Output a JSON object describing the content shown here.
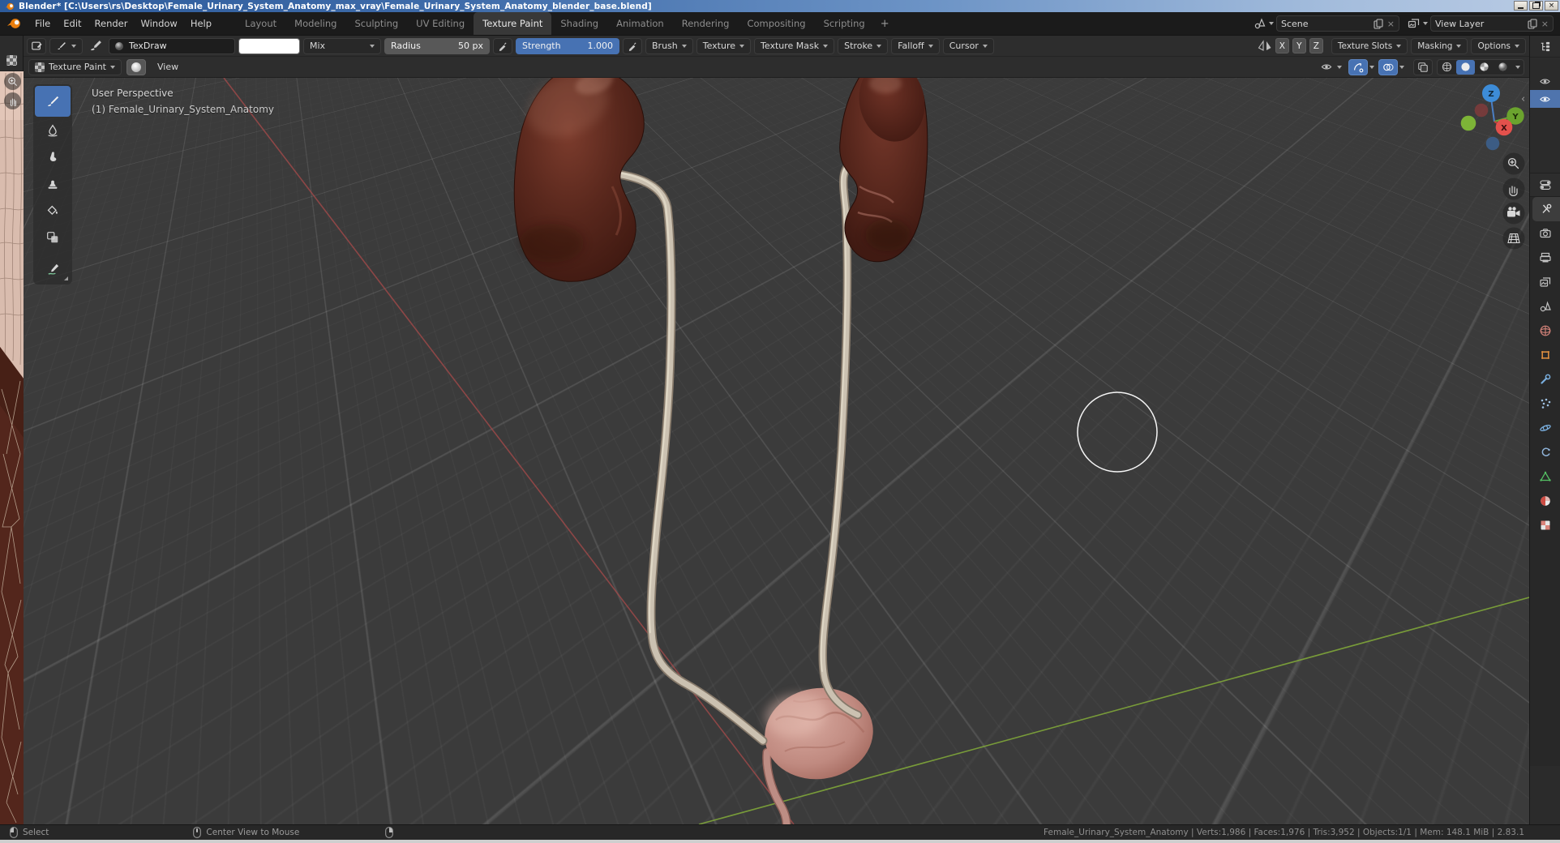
{
  "window": {
    "title": "Blender* [C:\\Users\\rs\\Desktop\\Female_Urinary_System_Anatomy_max_vray\\Female_Urinary_System_Anatomy_blender_base.blend]"
  },
  "topbar": {
    "menus": [
      "File",
      "Edit",
      "Render",
      "Window",
      "Help"
    ],
    "tabs": [
      "Layout",
      "Modeling",
      "Sculpting",
      "UV Editing",
      "Texture Paint",
      "Shading",
      "Animation",
      "Rendering",
      "Compositing",
      "Scripting"
    ],
    "active_tab": "Texture Paint",
    "add_tab": "+",
    "scene": "Scene",
    "view_layer": "View Layer"
  },
  "tool_settings": {
    "brush_name": "TexDraw",
    "blend": "Mix",
    "radius_label": "Radius",
    "radius_value": "50 px",
    "strength_label": "Strength",
    "strength_value": "1.000",
    "panels": [
      "Brush",
      "Texture",
      "Texture Mask",
      "Stroke",
      "Falloff",
      "Cursor"
    ],
    "axes": [
      "X",
      "Y",
      "Z"
    ],
    "right_panels": [
      "Texture Slots",
      "Masking",
      "Options"
    ]
  },
  "viewport": {
    "mode": "Texture Paint",
    "view_menu": "View",
    "overlay": {
      "line1": "User Perspective",
      "line2": "(1) Female_Urinary_System_Anatomy"
    },
    "gizmo": {
      "x": "X",
      "y": "Y",
      "z": "Z"
    },
    "tools": [
      "draw",
      "soften",
      "smear",
      "clone",
      "fill",
      "mask",
      "annotate"
    ],
    "collapse_arrow": "‹"
  },
  "properties": {
    "tabs": [
      "tool",
      "render",
      "output",
      "view-layer",
      "scene",
      "world",
      "object",
      "modifiers",
      "particles",
      "physics",
      "constraints",
      "data",
      "material",
      "texture"
    ]
  },
  "status": {
    "items": [
      {
        "label": "Select"
      },
      {
        "label": "Center View to Mouse"
      },
      {
        "label": ""
      }
    ],
    "stats": "Female_Urinary_System_Anatomy | Verts:1,986 | Faces:1,976 | Tris:3,952 | Objects:1/1 | Mem: 148.1 MiB | 2.83.1"
  },
  "colors": {
    "accent": "#4772b3",
    "viewport_bg": "#3b3b3b",
    "header_bg": "#2d2d2d",
    "topbar_bg": "#1b1b1b",
    "axis_x": "#a04a4a",
    "axis_y": "#84ad3a",
    "selection_blue": "#4f74ad",
    "titlebar_blue": "#3f6caa"
  }
}
